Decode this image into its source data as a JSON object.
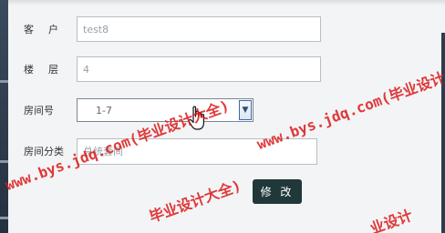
{
  "form": {
    "customer": {
      "label": "客户",
      "value": "test8"
    },
    "floor": {
      "label": "楼层",
      "value": "4"
    },
    "room_number": {
      "label": "房间号",
      "value": "1-7"
    },
    "room_category": {
      "label": "房间分类",
      "placeholder": "总统套间"
    },
    "submit_label": "修 改"
  },
  "watermark": {
    "text_long": "www.bys.jdq.com(毕业设计大全)",
    "text_short": "毕业设计大全)",
    "text_right": "www.bys.jdq.com(毕业设计",
    "text_tail": "业设计"
  },
  "colors": {
    "button_bg": "#21383a",
    "watermark": "#dc1e1e",
    "sidebar": "#2e3d50"
  }
}
